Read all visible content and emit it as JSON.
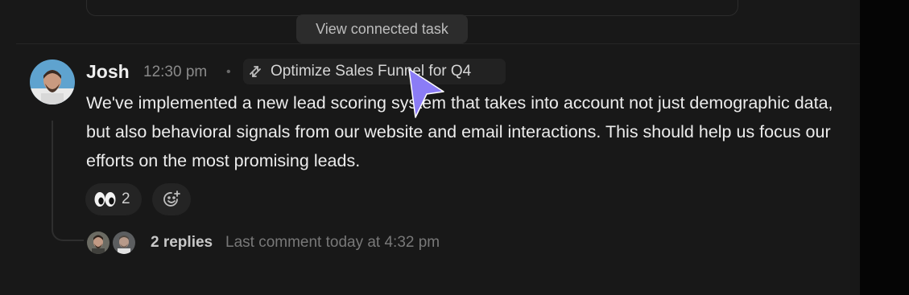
{
  "tooltip": {
    "text": "View connected task"
  },
  "comment": {
    "author": "Josh",
    "time": "12:30 pm",
    "separator": "•",
    "task_link": "Optimize Sales Funnel for Q4",
    "task_icon": "connected-task-icon",
    "body": "We've implemented a new lead scoring system that takes into account not just demographic data, but also behavioral signals from our website and email interactions. This should help us focus our efforts on the most promising leads.",
    "reactions": [
      {
        "emoji": "eyes",
        "count": "2"
      }
    ],
    "add_reaction_icon": "add-emoji-icon"
  },
  "replies": {
    "count_label": "2 replies",
    "last_comment": "Last comment today at 4:32 pm"
  },
  "colors": {
    "background": "#181818",
    "chip": "#222222",
    "cursor": "#8b7cf6",
    "text": "#ececec",
    "muted": "#8a8a8a"
  }
}
